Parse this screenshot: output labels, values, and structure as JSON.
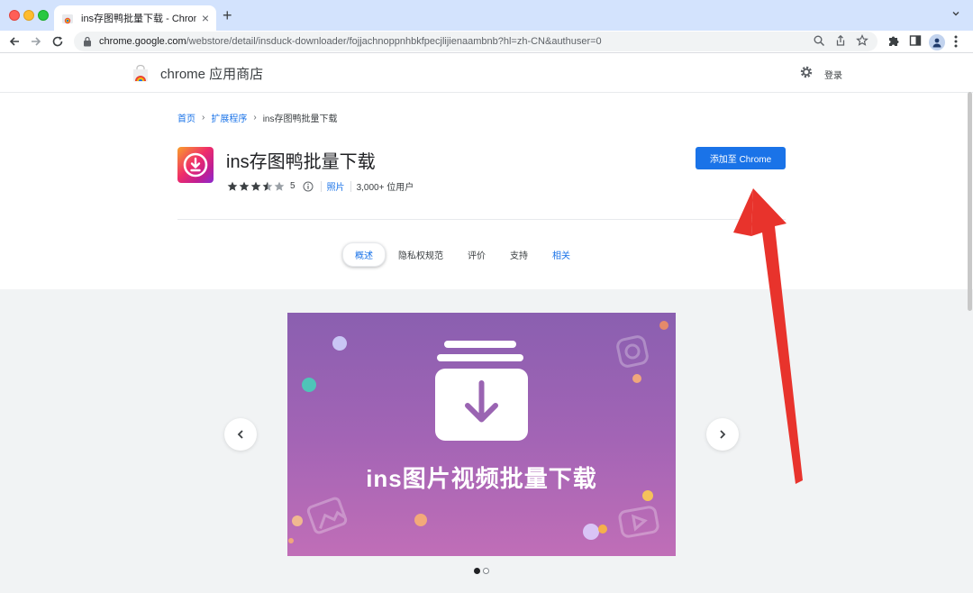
{
  "browser": {
    "tab_title": "ins存图鸭批量下载 - Chrome 应",
    "url_host": "chrome.google.com",
    "url_path": "/webstore/detail/insduck-downloader/fojjachnoppnhbkfpecjlijienaambnb?hl=zh-CN&authuser=0"
  },
  "header": {
    "store_title": "chrome 应用商店",
    "signin_label": "登录"
  },
  "breadcrumb": {
    "home": "首页",
    "extensions": "扩展程序",
    "current": "ins存图鸭批量下载"
  },
  "extension": {
    "name": "ins存图鸭批量下载",
    "rating": 3.5,
    "rating_count": "5",
    "category": "照片",
    "users": "3,000+ 位用户",
    "add_button_label": "添加至 Chrome"
  },
  "page_tabs": [
    "概述",
    "隐私权规范",
    "评价",
    "支持",
    "相关"
  ],
  "gallery": {
    "caption": "ins图片视频批量下载",
    "current_slide": 1,
    "total_slides": 2
  },
  "colors": {
    "accent": "#1a73e8",
    "annotation_arrow": "#e8332c"
  }
}
